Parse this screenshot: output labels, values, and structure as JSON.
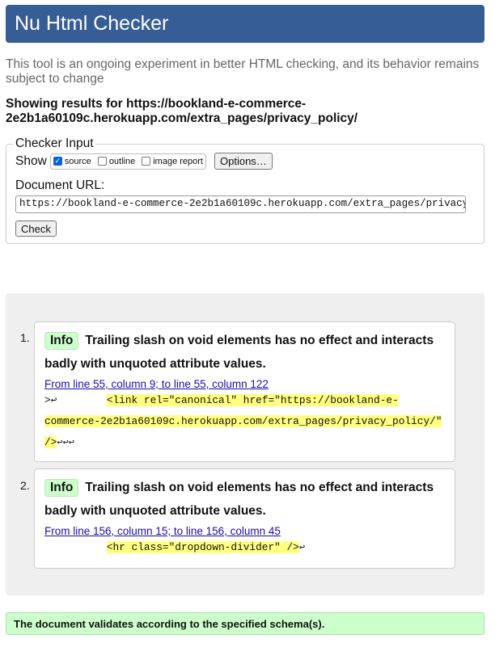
{
  "header": {
    "title": "Nu Html Checker"
  },
  "subtitle": "This tool is an ongoing experiment in better HTML checking, and its behavior remains subject to change",
  "results_for": "Showing results for https://bookland-e-commerce-2e2b1a60109c.herokuapp.com/extra_pages/privacy_policy/",
  "checker_input": {
    "legend": "Checker Input",
    "show_label": "Show",
    "options": [
      {
        "label": "source",
        "checked": true
      },
      {
        "label": "outline",
        "checked": false
      },
      {
        "label": "image report",
        "checked": false
      }
    ],
    "options_button": "Options…",
    "doc_url_label": "Document URL:",
    "doc_url_value": "https://bookland-e-commerce-2e2b1a60109c.herokuapp.com/extra_pages/privacy_policy/",
    "check_button": "Check"
  },
  "messages": [
    {
      "number": "1.",
      "badge": "Info",
      "text": "Trailing slash on void elements has no effect and interacts badly with unquoted attribute values.",
      "location": "From line 55, column 9; to line 55, column 122",
      "code_prefix": ">↩        ",
      "code_highlight": "<link rel=\"canonical\" href=\"https://bookland-e-commerce-2e2b1a60109c.herokuapp.com/extra_pages/privacy_policy/\" />",
      "code_suffix": "↩↩↩"
    },
    {
      "number": "2.",
      "badge": "Info",
      "text": "Trailing slash on void elements has no effect and interacts badly with unquoted attribute values.",
      "location": "From line 156, column 15; to line 156, column 45",
      "code_prefix": "          ",
      "code_highlight": "<hr class=\"dropdown-divider\" />",
      "code_suffix": "↩"
    }
  ],
  "validation_result": "The document validates according to the specified schema(s).",
  "colors": {
    "header_bg": "#365d95",
    "info_badge_bg": "#ccffcc",
    "highlight": "#ffff80",
    "success_bg": "#ccffcc"
  }
}
